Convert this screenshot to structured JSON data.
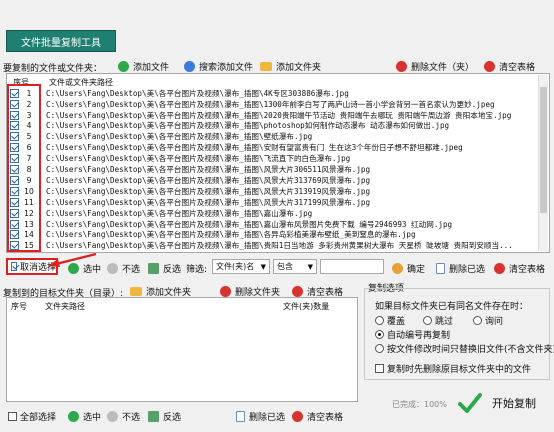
{
  "top_tab": "文件批量复制工具",
  "source": {
    "label": "要复制的文件或文件夹：",
    "add_file": "添加文件",
    "search_add": "搜索添加文件",
    "add_folder": "添加文件夹",
    "remove": "删除文件（夹）",
    "clear": "清空表格",
    "col_index": "序号",
    "col_path": "文件或文件夹路径",
    "rows": [
      {
        "n": "1",
        "path": "C:\\Users\\Fang\\Desktop\\美\\各平台图片及视频\\瀑布_插图\\4K专区303886瀑布.jpg"
      },
      {
        "n": "2",
        "path": "C:\\Users\\Fang\\Desktop\\美\\各平台图片及视频\\瀑布_插图\\1300年前李白写了两庐山诗一首小学会背另一首名家认为更妙.jpeg"
      },
      {
        "n": "3",
        "path": "C:\\Users\\Fang\\Desktop\\美\\各平台图片及视频\\瀑布_插图\\2020贵阳端午节活动 贵阳端午去哪玩 贵阳端午周边游 贵阳本地宝.jpg"
      },
      {
        "n": "4",
        "path": "C:\\Users\\Fang\\Desktop\\美\\各平台图片及视频\\瀑布_插图\\photoshop如何制作动态瀑布 动态瀑布如何做出.jpg"
      },
      {
        "n": "5",
        "path": "C:\\Users\\Fang\\Desktop\\美\\各平台图片及视频\\瀑布_插图\\壁纸瀑布.jpg"
      },
      {
        "n": "6",
        "path": "C:\\Users\\Fang\\Desktop\\美\\各平台图片及视频\\瀑布_插图\\安财有望富贵有门 生在这3个年份日子想不舒坦都难.jpeg"
      },
      {
        "n": "7",
        "path": "C:\\Users\\Fang\\Desktop\\美\\各平台图片及视频\\瀑布_插图\\飞流直下的白色瀑布.jpg"
      },
      {
        "n": "8",
        "path": "C:\\Users\\Fang\\Desktop\\美\\各平台图片及视频\\瀑布_插图\\风景大片306511风景瀑布.jpg"
      },
      {
        "n": "9",
        "path": "C:\\Users\\Fang\\Desktop\\美\\各平台图片及视频\\瀑布_插图\\风景大片313769风景瀑布.jpg"
      },
      {
        "n": "10",
        "path": "C:\\Users\\Fang\\Desktop\\美\\各平台图片及视频\\瀑布_插图\\风景大片313919风景瀑布.jpg"
      },
      {
        "n": "11",
        "path": "C:\\Users\\Fang\\Desktop\\美\\各平台图片及视频\\瀑布_插图\\风景大片317199风景瀑布.jpg"
      },
      {
        "n": "12",
        "path": "C:\\Users\\Fang\\Desktop\\美\\各平台图片及视频\\瀑布_插图\\嘉山瀑布.jpg"
      },
      {
        "n": "13",
        "path": "C:\\Users\\Fang\\Desktop\\美\\各平台图片及视频\\瀑布_插图\\嘉山瀑布风景图片免费下载 编号2946993 红动网.jpg"
      },
      {
        "n": "14",
        "path": "C:\\Users\\Fang\\Desktop\\美\\各平台图片及视频\\瀑布_插图\\各异岛彩植美瀑布壁纸_美到窒息的瀑布.jpg"
      },
      {
        "n": "15",
        "path": "C:\\Users\\Fang\\Desktop\\美\\各平台图片及视频\\瀑布_插图\\贵阳1日当地游 多彩贵州黄果树大瀑布 天星桥 陡坡塘 贵阳到安顺当..."
      }
    ]
  },
  "toolbar": {
    "cancel_select": "取消选择",
    "select": "选中",
    "unselect": "不选",
    "invert": "反选",
    "filter_label": "筛选:",
    "filter_field": "文件(夹)名",
    "filter_op": "包含",
    "filter_value": "",
    "confirm": "确定",
    "delete_selected": "删除已选",
    "clear": "清空表格"
  },
  "target": {
    "label": "复制到的目标文件夹（目录）:",
    "add_folder": "添加文件夹",
    "remove_folder": "删除文件夹",
    "clear": "清空表格",
    "col_index": "序号",
    "col_path": "文件夹路径",
    "col_count": "文件(夹)数量"
  },
  "options": {
    "title": "复制选项",
    "question": "如果目标文件夹已有同名文件存在时：",
    "opt_overwrite": "覆盖",
    "opt_skip": "跳过",
    "opt_ask": "询问",
    "opt_auto_rename": "自动编号再复制",
    "opt_by_time": "按文件修改时间只替换旧文件(不含文件夹)",
    "opt_delete_first": "复制时先删除原目标文件夹中的文件"
  },
  "bottom": {
    "select_all": "全部选择",
    "select": "选中",
    "unselect": "不选",
    "invert": "反选",
    "delete_selected": "删除已选",
    "clear": "清空表格",
    "progress_text": "已完成：100%",
    "start": "开始复制"
  },
  "colors": {
    "tab_bg": "#1f7f70",
    "highlight_red": "#e02020",
    "check_green": "#2ea84a"
  }
}
